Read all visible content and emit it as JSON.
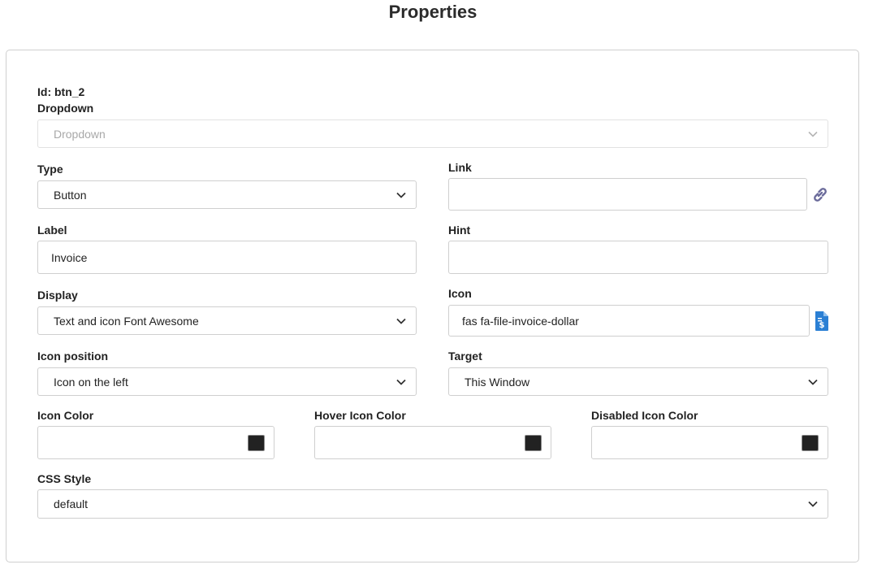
{
  "title": "Properties",
  "id_line": "Id: btn_2",
  "dropdown": {
    "label": "Dropdown",
    "value": "Dropdown"
  },
  "type": {
    "label": "Type",
    "value": "Button"
  },
  "link": {
    "label": "Link",
    "value": "",
    "icon": "link-icon"
  },
  "label_field": {
    "label": "Label",
    "value": "Invoice"
  },
  "hint": {
    "label": "Hint",
    "value": ""
  },
  "display": {
    "label": "Display",
    "value": "Text and icon Font Awesome"
  },
  "icon_field": {
    "label": "Icon",
    "value": "fas fa-file-invoice-dollar",
    "icon": "file-invoice-dollar-icon"
  },
  "icon_position": {
    "label": "Icon position",
    "value": "Icon on the left"
  },
  "target": {
    "label": "Target",
    "value": "This Window"
  },
  "icon_color": {
    "label": "Icon Color",
    "value": "",
    "swatch": "#222222"
  },
  "hover_icon_color": {
    "label": "Hover Icon Color",
    "value": "",
    "swatch": "#222222"
  },
  "disabled_icon_color": {
    "label": "Disabled Icon Color",
    "value": "",
    "swatch": "#222222"
  },
  "css_style": {
    "label": "CSS Style",
    "value": "default"
  },
  "colors": {
    "accent": "#2a7fd4",
    "link_icon": "#6a6a9a",
    "border": "#cfcfcf"
  }
}
